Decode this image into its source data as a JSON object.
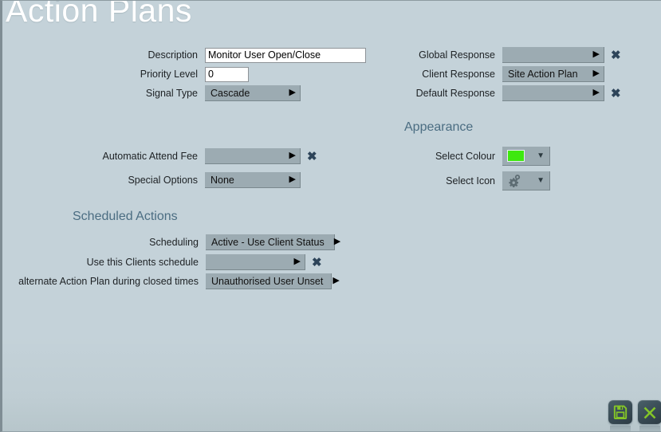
{
  "window": {
    "title": "Action Plans",
    "background_color": "#c4d2d9",
    "title_color": "#ffffff"
  },
  "sections": {
    "appearance_heading": "Appearance",
    "scheduled_actions_heading": "Scheduled Actions"
  },
  "fields": {
    "description": {
      "label": "Description",
      "value": "Monitor User Open/Close",
      "placeholder": ""
    },
    "priority_level": {
      "label": "Priority Level",
      "value": "0",
      "placeholder": ""
    },
    "signal_type": {
      "label": "Signal Type",
      "value": "Cascade"
    },
    "automatic_attend_fee": {
      "label": "Automatic Attend Fee",
      "value": ""
    },
    "special_options": {
      "label": "Special Options",
      "value": "None"
    },
    "global_response": {
      "label": "Global Response",
      "value": ""
    },
    "client_response": {
      "label": "Client Response",
      "value": "Site Action Plan"
    },
    "default_response": {
      "label": "Default Response",
      "value": ""
    },
    "select_colour": {
      "label": "Select Colour",
      "value_color": "#3ee80e"
    },
    "select_icon": {
      "label": "Select Icon",
      "icon_name": "gear-icon"
    },
    "scheduling": {
      "label": "Scheduling",
      "value": "Active - Use Client Status"
    },
    "use_clients_schedule": {
      "label": "Use this Clients schedule",
      "value": ""
    },
    "alternate_action_plan": {
      "label": "alternate Action Plan during closed times",
      "value": "Unauthorised User Unset"
    }
  },
  "glyphs": {
    "caret_right": "▶",
    "caret_down": "▼",
    "clear_x": "✖"
  },
  "buttons": {
    "save": {
      "name": "save-button",
      "icon": "floppy-disk-icon",
      "color": "#84c528"
    },
    "close": {
      "name": "close-button",
      "icon": "x-icon",
      "color": "#84c528"
    }
  }
}
